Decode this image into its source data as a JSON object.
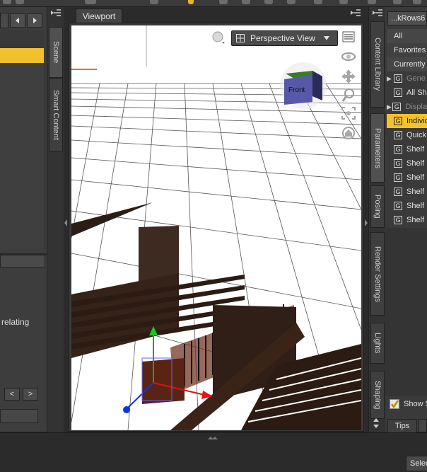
{
  "viewport": {
    "tab_label": "Viewport",
    "view_mode": "Perspective View",
    "cube_face_label": "Front"
  },
  "left_tabs": {
    "scene": "Scene",
    "smart_content": "Smart Content"
  },
  "left_panel": {
    "partial_text": "relating",
    "prev_arrow": "<",
    "next_arrow": ">"
  },
  "right_tabs": {
    "content_library": "Content Library",
    "parameters": "Parameters",
    "posing": "Posing",
    "render_settings": "Render Settings",
    "lights": "Lights",
    "shaping": "Shaping"
  },
  "right_panel": {
    "header": "...kRows6",
    "filter_items": [
      "All",
      "Favorites",
      "Currently"
    ],
    "groups": [
      {
        "label": "Gene",
        "expander": true,
        "dim": true,
        "selected": false
      },
      {
        "label": "All Sh",
        "expander": false,
        "dim": false,
        "selected": false
      },
      {
        "label": "Displa",
        "expander": true,
        "dim": true,
        "selected": false
      },
      {
        "label": "Individ",
        "expander": false,
        "dim": false,
        "selected": true
      },
      {
        "label": "Quick",
        "expander": false,
        "dim": false,
        "selected": false
      },
      {
        "label": "Shelf",
        "expander": false,
        "dim": false,
        "selected": false
      },
      {
        "label": "Shelf",
        "expander": false,
        "dim": false,
        "selected": false
      },
      {
        "label": "Shelf",
        "expander": false,
        "dim": false,
        "selected": false
      },
      {
        "label": "Shelf",
        "expander": false,
        "dim": false,
        "selected": false
      },
      {
        "label": "Shelf",
        "expander": false,
        "dim": false,
        "selected": false
      },
      {
        "label": "Shelf",
        "expander": false,
        "dim": false,
        "selected": false
      }
    ],
    "group_icon": "G",
    "show_checkbox_label": "Show S",
    "tips_tab": "Tips"
  },
  "status": {
    "select_label": "Selec"
  },
  "colors": {
    "selection": "#f2c12e",
    "panel": "#3a3a3a",
    "viewport_bg": "#ffffff",
    "shelf_wood": "#3a2418"
  },
  "icons": [
    "gear-icon",
    "camera-sphere-icon",
    "rotate-orbit-icon",
    "pan-move-icon",
    "zoom-icon",
    "frame-icon",
    "home-icon",
    "menu-lines-icon",
    "dropdown-arrow-icon",
    "checkbox-check-icon"
  ]
}
